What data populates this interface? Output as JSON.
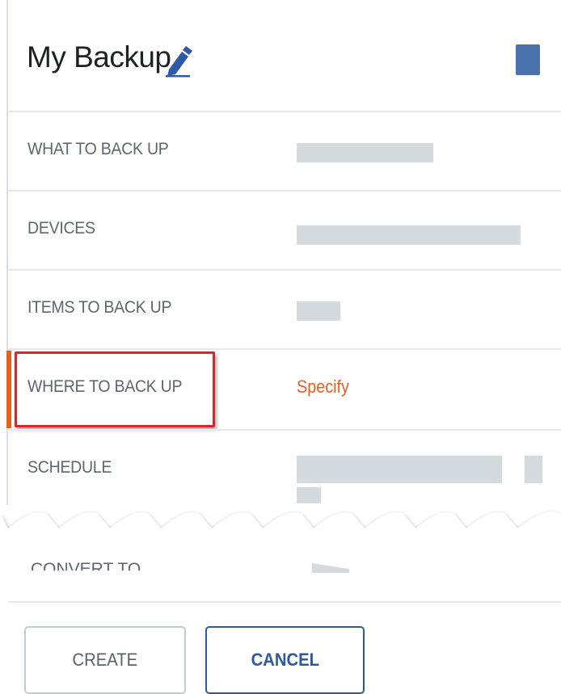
{
  "header": {
    "title": "My Backup",
    "edit_icon": "pencil-icon",
    "accent_color": "#4a73ad"
  },
  "rows": [
    {
      "label": "WHAT TO BACK UP",
      "value": ""
    },
    {
      "label": "DEVICES",
      "value": ""
    },
    {
      "label": "ITEMS TO BACK UP",
      "value": ""
    },
    {
      "label": "WHERE TO BACK UP",
      "value": "Specify"
    },
    {
      "label": "SCHEDULE",
      "value": ""
    }
  ],
  "cut_row": {
    "label": "CONVERT TO ..."
  },
  "buttons": {
    "create": "CREATE",
    "cancel": "CANCEL"
  },
  "colors": {
    "link_orange": "#e3611c",
    "highlight_red": "#d8262b",
    "cancel_blue": "#2b5a9e"
  }
}
